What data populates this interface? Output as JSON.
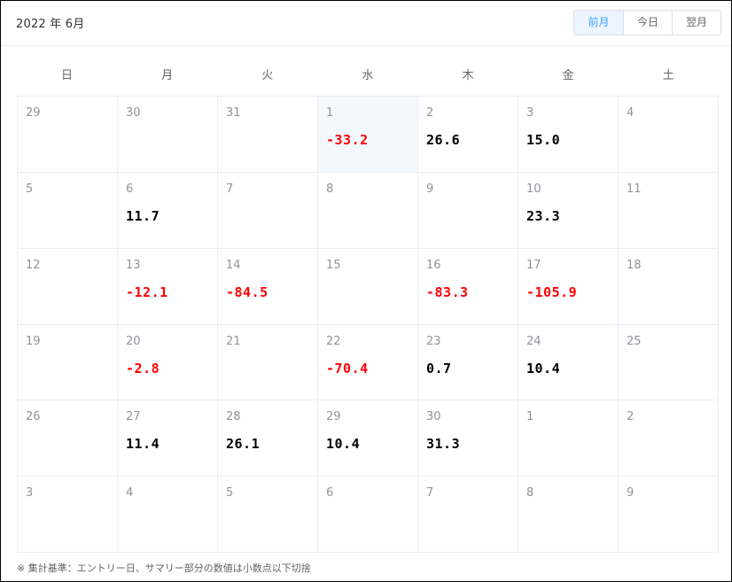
{
  "header": {
    "title": "2022 年 6月",
    "buttons": [
      {
        "label": "前月",
        "active": true
      },
      {
        "label": "今日",
        "active": false
      },
      {
        "label": "翌月",
        "active": false
      }
    ]
  },
  "weekdays": [
    "日",
    "月",
    "火",
    "水",
    "木",
    "金",
    "土"
  ],
  "colors": {
    "negative": "#ff0000",
    "positive": "#000000",
    "selected_bg": "#f2f8fe",
    "accent": "#409eff"
  },
  "cells": [
    {
      "day": "29",
      "value": ""
    },
    {
      "day": "30",
      "value": ""
    },
    {
      "day": "31",
      "value": ""
    },
    {
      "day": "1",
      "value": "-33.2",
      "selected": true
    },
    {
      "day": "2",
      "value": "26.6"
    },
    {
      "day": "3",
      "value": "15.0"
    },
    {
      "day": "4",
      "value": ""
    },
    {
      "day": "5",
      "value": ""
    },
    {
      "day": "6",
      "value": "11.7"
    },
    {
      "day": "7",
      "value": ""
    },
    {
      "day": "8",
      "value": ""
    },
    {
      "day": "9",
      "value": ""
    },
    {
      "day": "10",
      "value": "23.3"
    },
    {
      "day": "11",
      "value": ""
    },
    {
      "day": "12",
      "value": ""
    },
    {
      "day": "13",
      "value": "-12.1"
    },
    {
      "day": "14",
      "value": "-84.5"
    },
    {
      "day": "15",
      "value": ""
    },
    {
      "day": "16",
      "value": "-83.3"
    },
    {
      "day": "17",
      "value": "-105.9"
    },
    {
      "day": "18",
      "value": ""
    },
    {
      "day": "19",
      "value": ""
    },
    {
      "day": "20",
      "value": "-2.8"
    },
    {
      "day": "21",
      "value": ""
    },
    {
      "day": "22",
      "value": "-70.4"
    },
    {
      "day": "23",
      "value": "0.7"
    },
    {
      "day": "24",
      "value": "10.4"
    },
    {
      "day": "25",
      "value": ""
    },
    {
      "day": "26",
      "value": ""
    },
    {
      "day": "27",
      "value": "11.4"
    },
    {
      "day": "28",
      "value": "26.1"
    },
    {
      "day": "29",
      "value": "10.4"
    },
    {
      "day": "30",
      "value": "31.3"
    },
    {
      "day": "1",
      "value": ""
    },
    {
      "day": "2",
      "value": ""
    },
    {
      "day": "3",
      "value": ""
    },
    {
      "day": "4",
      "value": ""
    },
    {
      "day": "5",
      "value": ""
    },
    {
      "day": "6",
      "value": ""
    },
    {
      "day": "7",
      "value": ""
    },
    {
      "day": "8",
      "value": ""
    },
    {
      "day": "9",
      "value": ""
    }
  ],
  "footer": {
    "note": "※ 集計基準：エントリー日、サマリー部分の数値は小数点以下切捨"
  }
}
